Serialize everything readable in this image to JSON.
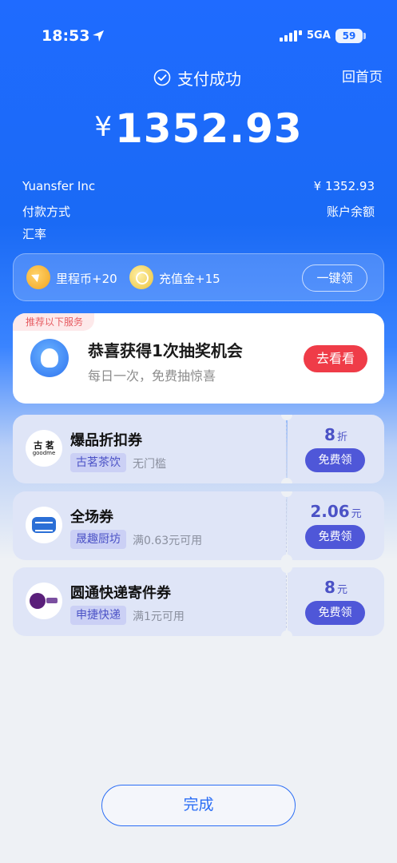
{
  "status_bar": {
    "time": "18:53",
    "network": "5GA",
    "battery": "59"
  },
  "header": {
    "pay_status": "支付成功",
    "home_link": "回首页"
  },
  "amount": {
    "currency": "¥",
    "value": "1352.93"
  },
  "details": [
    {
      "label": "Yuansfer Inc",
      "value": "¥ 1352.93"
    },
    {
      "label": "付款方式",
      "value": "账户余额"
    },
    {
      "label": "汇率",
      "value": ""
    }
  ],
  "rewards": {
    "items": [
      {
        "label": "里程币+20",
        "icon": "mileage-coin-icon"
      },
      {
        "label": "充值金+15",
        "icon": "recharge-coin-icon"
      }
    ],
    "claim_all": "一键领"
  },
  "lottery": {
    "tag": "推荐以下服务",
    "title": "恭喜获得1次抽奖机会",
    "subtitle": "每日一次，免费抽惊喜",
    "button": "去看看"
  },
  "coupons": [
    {
      "title": "爆品折扣券",
      "brand": "古茗茶饮",
      "condition": "无门槛",
      "value": "8",
      "unit": "折",
      "button": "免费领",
      "logo_text": "古 茗",
      "logo_sub": "goodme"
    },
    {
      "title": "全场券",
      "brand": "晟趣厨坊",
      "condition": "满0.63元可用",
      "value": "2.06",
      "unit": "元",
      "button": "免费领"
    },
    {
      "title": "圆通快递寄件券",
      "brand": "申捷快递",
      "condition": "满1元可用",
      "value": "8",
      "unit": "元",
      "button": "免费领"
    }
  ],
  "footer": {
    "done": "完成"
  },
  "colors": {
    "primary": "#1f6bff",
    "danger": "#ef3c48",
    "coupon_accent": "#4f57d8"
  }
}
